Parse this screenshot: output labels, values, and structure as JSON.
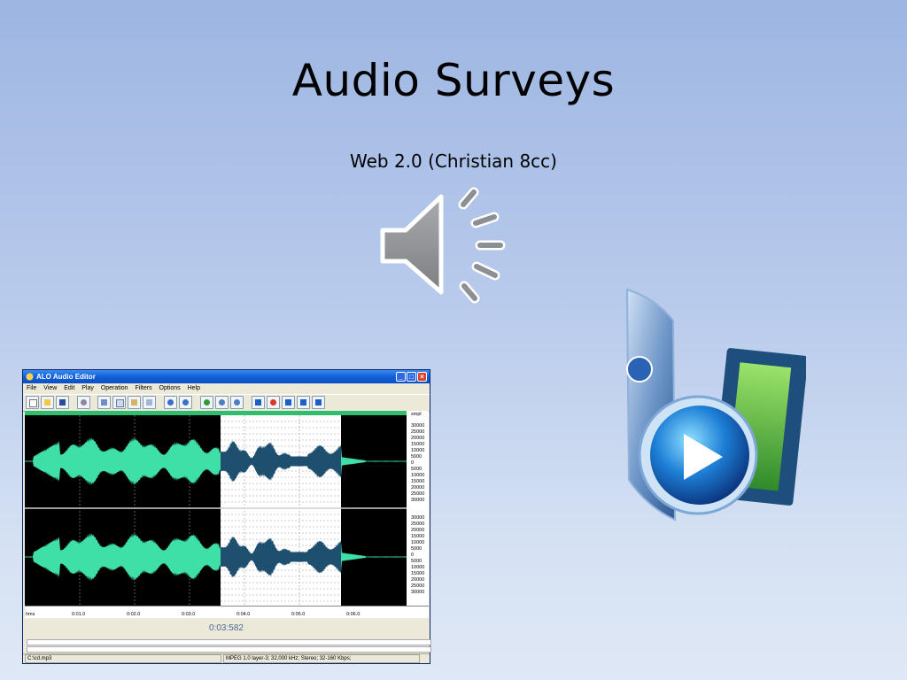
{
  "slide": {
    "title": "Audio Surveys",
    "subtitle": "Web 2.0 (Christian 8cc)"
  },
  "icons": {
    "speaker": "speaker-sound-icon",
    "media": "windows-media-video-folder-icon"
  },
  "editor": {
    "window_title": "ALO Audio Editor",
    "menu": [
      "File",
      "View",
      "Edit",
      "Play",
      "Operation",
      "Filters",
      "Options",
      "Help"
    ],
    "toolbar_icons": [
      "new-icon",
      "open-icon",
      "save-icon",
      "settings-icon",
      "link-icon",
      "copy-icon",
      "paste-icon",
      "trim-icon",
      "undo-icon",
      "redo-icon",
      "zoom-in-icon",
      "zoom-out-icon",
      "zoom-fit-icon",
      "play-icon",
      "record-icon",
      "pause-icon",
      "play-selection-icon",
      "stop-icon"
    ],
    "scale_unit": "smpl",
    "scale_labels": [
      "30000",
      "25000",
      "20000",
      "15000",
      "10000",
      "5000",
      "0",
      "5000",
      "10000",
      "15000",
      "20000",
      "25000",
      "30000"
    ],
    "scale_labels_ch2": [
      "30000",
      "25000",
      "20000",
      "15000",
      "10000",
      "5000",
      "0",
      "5000",
      "10000",
      "15000",
      "20000",
      "25000",
      "30000"
    ],
    "timeline_unit": "hms",
    "timeline_ticks": [
      "0:01.0",
      "0:02.0",
      "0:03.0",
      "0:04.0",
      "0:05.0",
      "0:06.0"
    ],
    "time_readout": "0:03:582",
    "status_file": "C:\\cd.mp3",
    "status_format": "MPEG 1.0 layer-3; 32,000 kHz; Stereo; 32-160 Kbps;",
    "colors": {
      "waveform": "#3fe0a8",
      "waveform_selected": "#1f4f6f",
      "background": "#000000",
      "selection_background": "#ffffff",
      "title_bar": "#1160d8"
    }
  }
}
